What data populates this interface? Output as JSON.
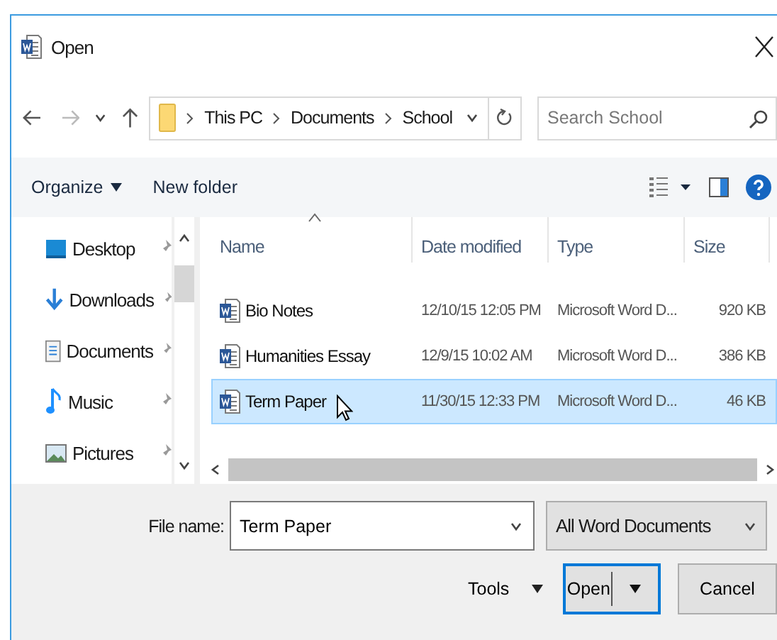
{
  "window": {
    "title": "Open"
  },
  "address_bar": {
    "path": [
      "This PC",
      "Documents",
      "School"
    ]
  },
  "search": {
    "placeholder": "Search School"
  },
  "toolbar": {
    "organize": "Organize",
    "new_folder": "New folder"
  },
  "sidebar": {
    "items": [
      {
        "label": "Desktop",
        "kind": "desktop"
      },
      {
        "label": "Downloads",
        "kind": "downloads"
      },
      {
        "label": "Documents",
        "kind": "documents"
      },
      {
        "label": "Music",
        "kind": "music"
      },
      {
        "label": "Pictures",
        "kind": "pictures"
      }
    ]
  },
  "table": {
    "columns": [
      "Name",
      "Date modified",
      "Type",
      "Size"
    ],
    "rows": [
      {
        "name": "Bio Notes",
        "date": "12/10/15 12:05 PM",
        "type": "Microsoft Word D...",
        "size": "920 KB",
        "selected": false
      },
      {
        "name": "Humanities Essay",
        "date": "12/9/15 10:02 AM",
        "type": "Microsoft Word D...",
        "size": "386 KB",
        "selected": false
      },
      {
        "name": "Term Paper",
        "date": "11/30/15 12:33 PM",
        "type": "Microsoft Word D...",
        "size": "46 KB",
        "selected": true
      }
    ]
  },
  "footer": {
    "file_name_label": "File name:",
    "file_name": "Term Paper",
    "file_type": "All Word Documents",
    "tools": "Tools",
    "open": "Open",
    "cancel": "Cancel"
  }
}
